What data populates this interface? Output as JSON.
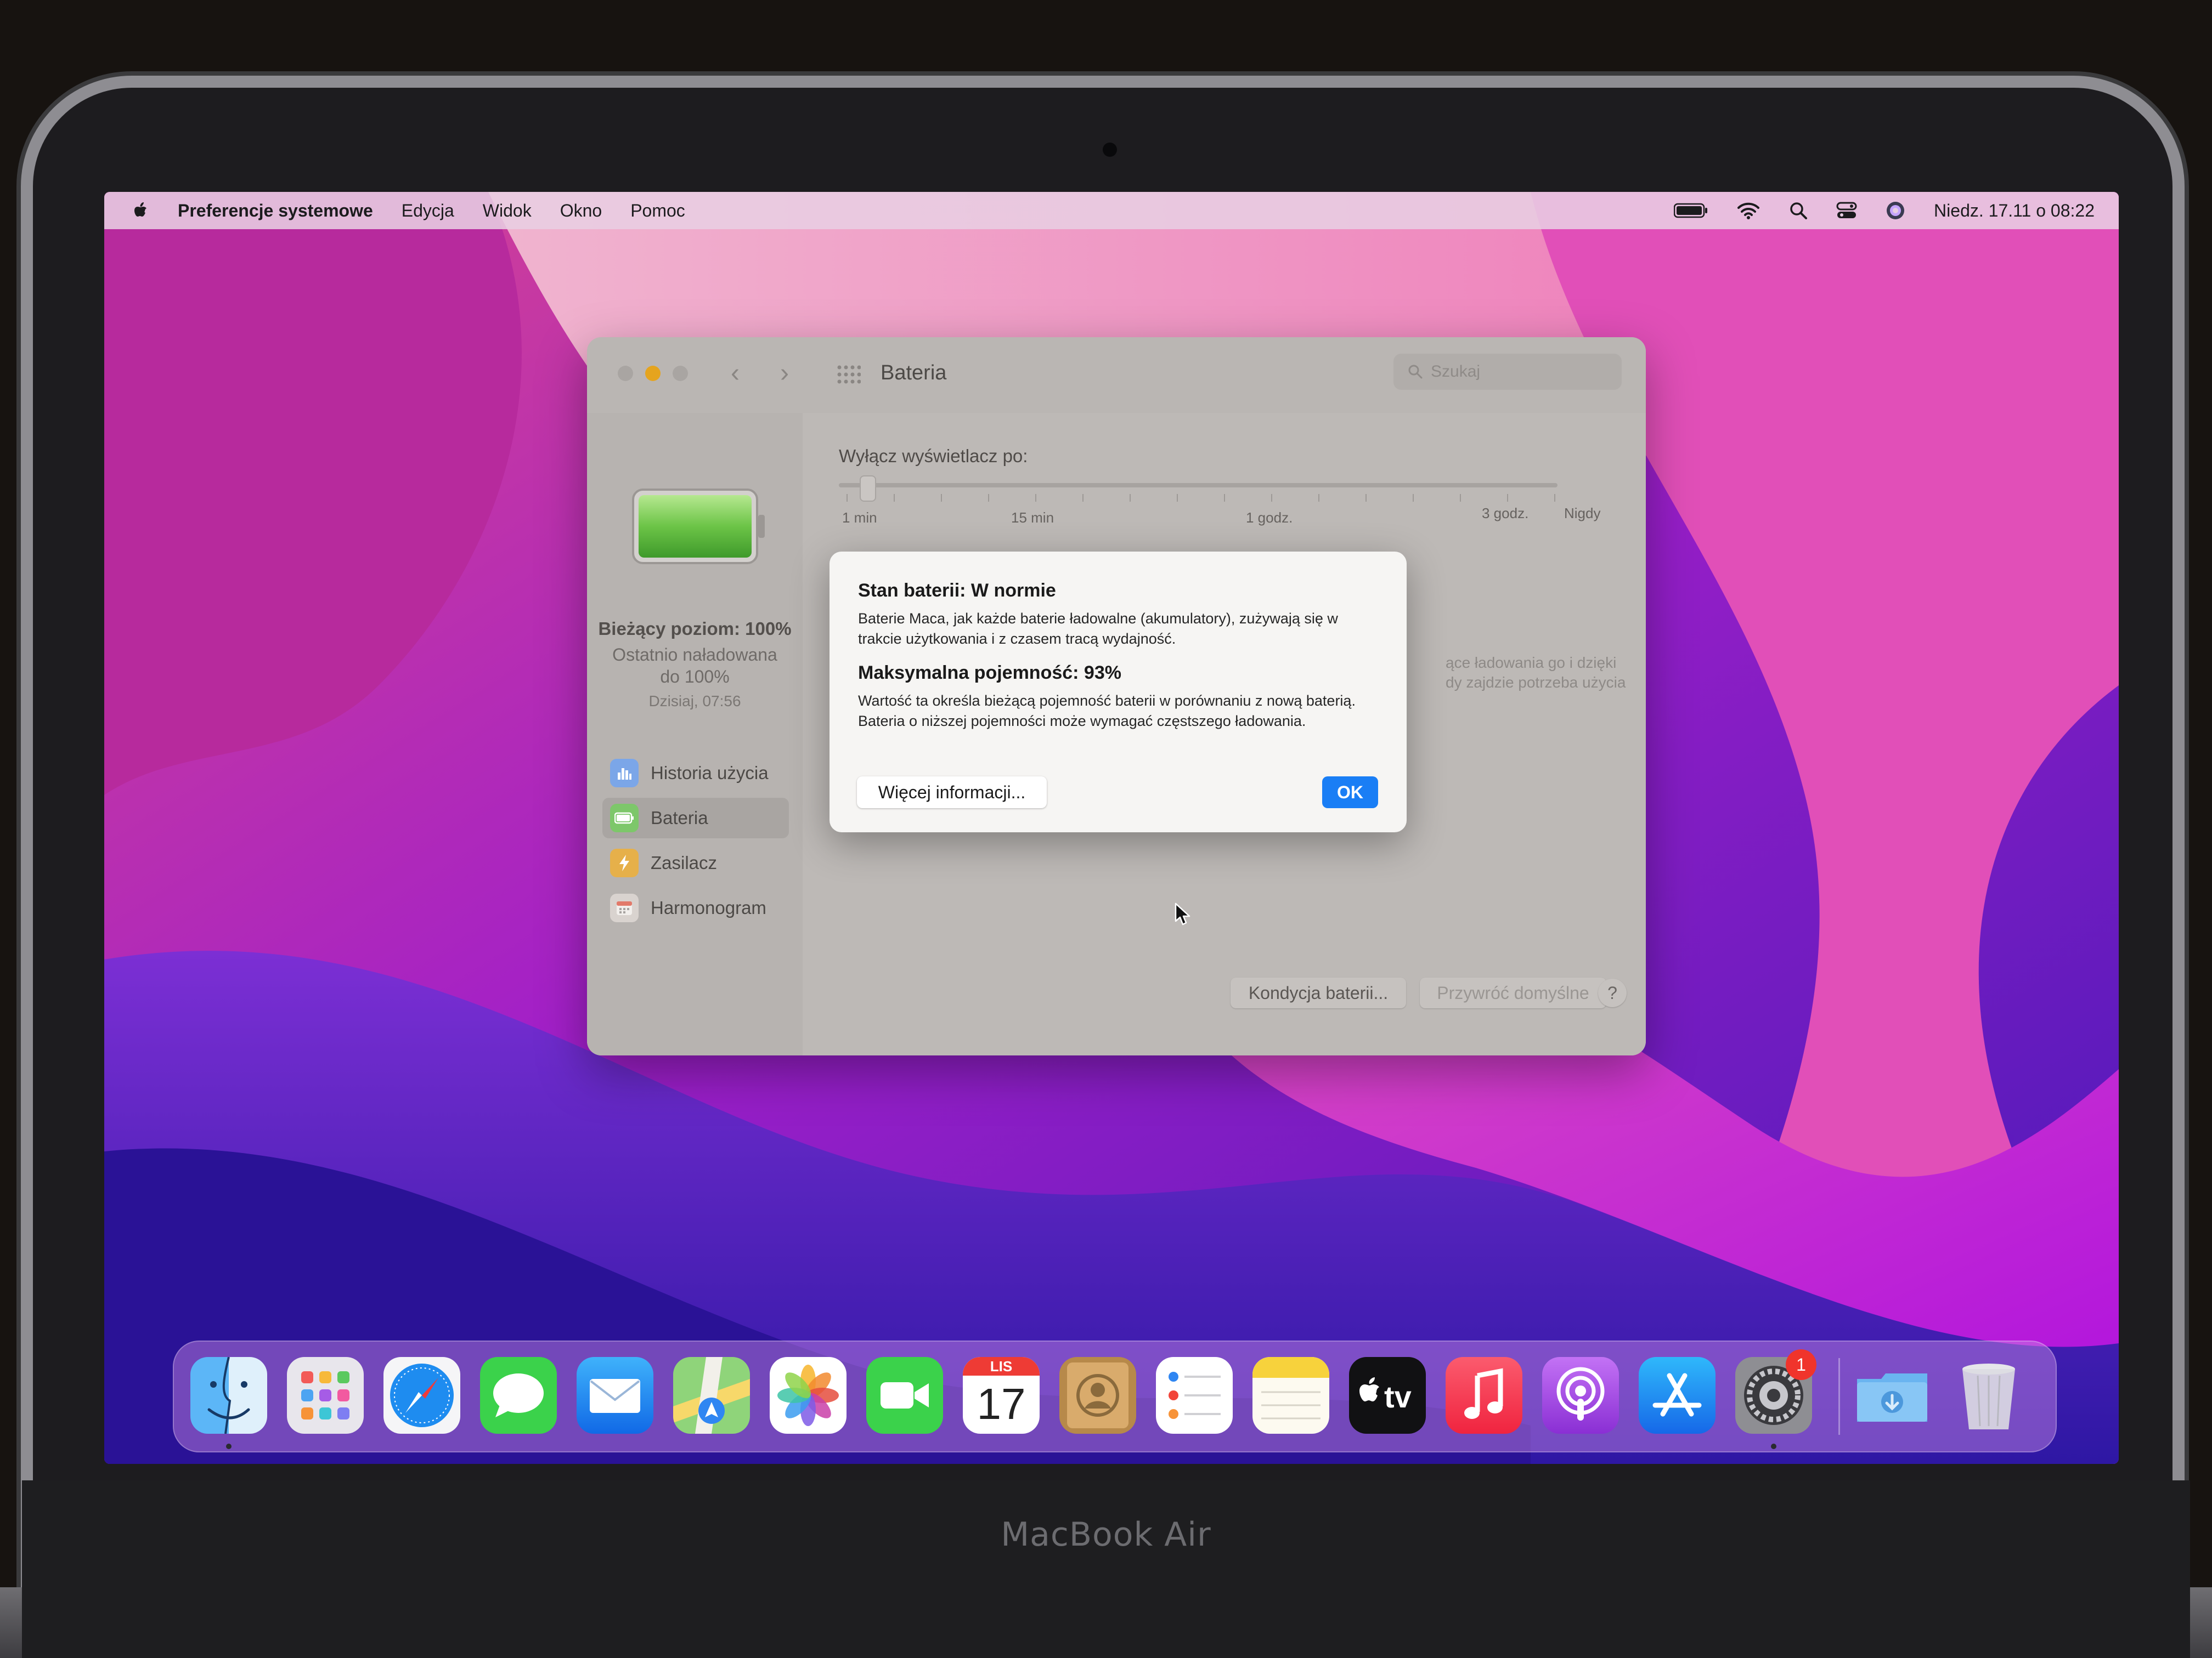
{
  "device": {
    "model_label": "MacBook Air"
  },
  "menubar": {
    "app_name": "Preferencje systemowe",
    "items": [
      "Edycja",
      "Widok",
      "Okno",
      "Pomoc"
    ],
    "clock": "Niedz. 17.11 o 08:22",
    "status_icons": [
      "battery-icon",
      "wifi-icon",
      "spotlight-search-icon",
      "control-center-icon",
      "siri-icon"
    ]
  },
  "window": {
    "title": "Bateria",
    "search_placeholder": "Szukaj",
    "sidebar": {
      "current_level": "Bieżący poziom: 100%",
      "last_charged_line1": "Ostatnio naładowana",
      "last_charged_line2": "do 100%",
      "last_charged_time": "Dzisiaj, 07:56",
      "items": [
        {
          "label": "Historia użycia",
          "icon": "usage-history-icon",
          "color": "#7ba6e8"
        },
        {
          "label": "Bateria",
          "icon": "battery-icon",
          "color": "#7dc76a"
        },
        {
          "label": "Zasilacz",
          "icon": "power-adapter-icon",
          "color": "#e6b04a"
        },
        {
          "label": "Harmonogram",
          "icon": "calendar-icon",
          "color": "#d9d3cf"
        }
      ],
      "selected_index": 1
    },
    "content": {
      "slider_label": "Wyłącz wyświetlacz po:",
      "slider_ticks": [
        "1 min",
        "15 min",
        "1 godz.",
        "3 godz.",
        "Nigdy"
      ],
      "faded_text_line1": "ące ładowania go i dzięki",
      "faded_text_line2": "dy zajdzie potrzeba użycia",
      "battery_health_button": "Kondycja baterii...",
      "restore_defaults_button": "Przywróć domyślne",
      "help_button": "?"
    }
  },
  "alert": {
    "title": "Stan baterii: W normie",
    "body": "Baterie Maca, jak każde baterie ładowalne (akumulatory), zużywają się w trakcie użytkowania i z czasem tracą wydajność.",
    "capacity_title": "Maksymalna pojemność: 93%",
    "capacity_body": "Wartość ta określa bieżącą pojemność baterii w porównaniu z nową baterią. Bateria o niższej pojemności może wymagać częstszego ładowania.",
    "more_info_button": "Więcej informacji...",
    "ok_button": "OK"
  },
  "dock": {
    "apps": [
      {
        "name": "finder-icon",
        "running": true
      },
      {
        "name": "launchpad-icon"
      },
      {
        "name": "safari-icon"
      },
      {
        "name": "messages-icon"
      },
      {
        "name": "mail-icon"
      },
      {
        "name": "maps-icon"
      },
      {
        "name": "photos-icon"
      },
      {
        "name": "facetime-icon"
      },
      {
        "name": "calendar-icon"
      },
      {
        "name": "contacts-icon"
      },
      {
        "name": "reminders-icon"
      },
      {
        "name": "notes-icon"
      },
      {
        "name": "apple-tv-icon"
      },
      {
        "name": "music-icon"
      },
      {
        "name": "podcasts-icon"
      },
      {
        "name": "app-store-icon"
      },
      {
        "name": "system-preferences-icon",
        "running": true,
        "badge": "1"
      }
    ],
    "calendar_month": "LIS",
    "calendar_day": "17",
    "tv_label": "tv",
    "extras": [
      "downloads-folder-icon",
      "trash-icon"
    ]
  }
}
